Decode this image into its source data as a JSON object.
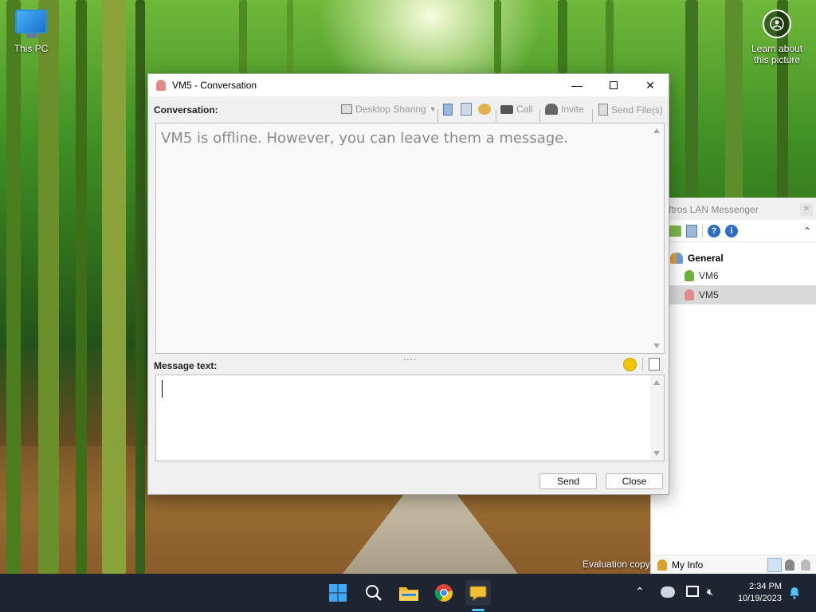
{
  "desktop": {
    "this_pc_label": "This PC",
    "learn_label_line1": "Learn about",
    "learn_label_line2": "this picture",
    "evaluation_text": "Evaluation copy"
  },
  "messenger": {
    "title": "ftros LAN Messenger",
    "group_name": "General",
    "users": [
      {
        "name": "VM6",
        "status": "online"
      },
      {
        "name": "VM5",
        "status": "offline"
      }
    ],
    "my_info_label": "My Info"
  },
  "conversation": {
    "title": "VM5 - Conversation",
    "conversation_label": "Conversation:",
    "toolbar": {
      "desktop_sharing": "Desktop Sharing",
      "call": "Call",
      "invite": "Invite",
      "send_files": "Send File(s)"
    },
    "offline_message": "VM5 is offline. However, you can leave them a message.",
    "message_text_label": "Message text:",
    "message_value": "",
    "send_label": "Send",
    "close_label": "Close"
  },
  "taskbar": {
    "time": "2:34 PM",
    "date": "10/19/2023"
  },
  "colors": {
    "taskbar_bg": "#1f2530",
    "accent": "#0078d4",
    "selected_row": "#d9d9d9"
  }
}
